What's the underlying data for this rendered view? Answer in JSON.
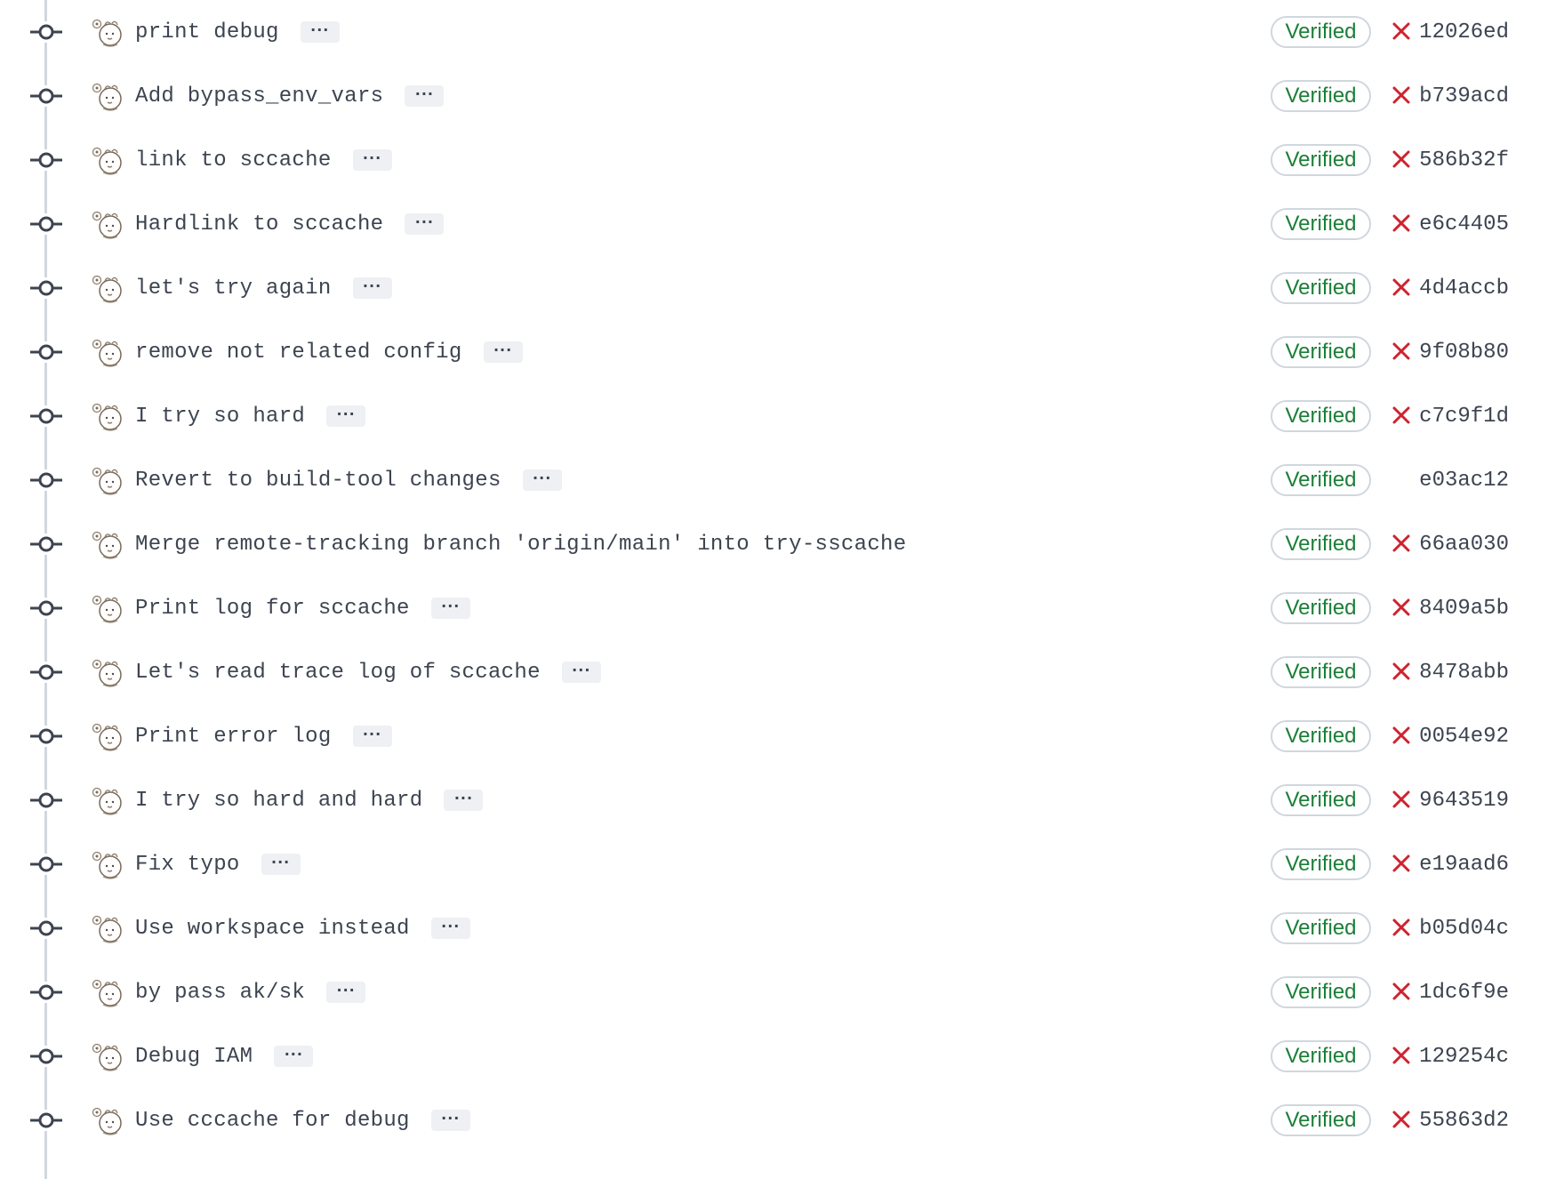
{
  "colors": {
    "timeline": "#d0d7de",
    "text": "#3d4450",
    "verified_text": "#1a7f37",
    "verified_border": "#d0d7de",
    "failure": "#cf222e",
    "ellipsis_bg": "#eef0f3"
  },
  "icons": {
    "node": "git-commit-icon",
    "avatar": "cartoon-avatar",
    "failure": "x-icon"
  },
  "commits": [
    {
      "message": "print debug",
      "has_ellipsis": true,
      "badge": "Verified",
      "status": "failure",
      "sha": "12026ed"
    },
    {
      "message": "Add bypass_env_vars",
      "has_ellipsis": true,
      "badge": "Verified",
      "status": "failure",
      "sha": "b739acd"
    },
    {
      "message": "link to sccache",
      "has_ellipsis": true,
      "badge": "Verified",
      "status": "failure",
      "sha": "586b32f"
    },
    {
      "message": "Hardlink to sccache",
      "has_ellipsis": true,
      "badge": "Verified",
      "status": "failure",
      "sha": "e6c4405"
    },
    {
      "message": "let's try again",
      "has_ellipsis": true,
      "badge": "Verified",
      "status": "failure",
      "sha": "4d4accb"
    },
    {
      "message": "remove not related config",
      "has_ellipsis": true,
      "badge": "Verified",
      "status": "failure",
      "sha": "9f08b80"
    },
    {
      "message": "I try so hard",
      "has_ellipsis": true,
      "badge": "Verified",
      "status": "failure",
      "sha": "c7c9f1d"
    },
    {
      "message": "Revert to build-tool changes",
      "has_ellipsis": true,
      "badge": "Verified",
      "status": "none",
      "sha": "e03ac12"
    },
    {
      "message": "Merge remote-tracking branch 'origin/main' into try-sscache",
      "has_ellipsis": false,
      "badge": "Verified",
      "status": "failure",
      "sha": "66aa030"
    },
    {
      "message": "Print log for sccache",
      "has_ellipsis": true,
      "badge": "Verified",
      "status": "failure",
      "sha": "8409a5b"
    },
    {
      "message": "Let's read trace log of sccache",
      "has_ellipsis": true,
      "badge": "Verified",
      "status": "failure",
      "sha": "8478abb"
    },
    {
      "message": "Print error log",
      "has_ellipsis": true,
      "badge": "Verified",
      "status": "failure",
      "sha": "0054e92"
    },
    {
      "message": "I try so hard and hard",
      "has_ellipsis": true,
      "badge": "Verified",
      "status": "failure",
      "sha": "9643519"
    },
    {
      "message": "Fix typo",
      "has_ellipsis": true,
      "badge": "Verified",
      "status": "failure",
      "sha": "e19aad6"
    },
    {
      "message": "Use workspace instead",
      "has_ellipsis": true,
      "badge": "Verified",
      "status": "failure",
      "sha": "b05d04c"
    },
    {
      "message": "by pass ak/sk",
      "has_ellipsis": true,
      "badge": "Verified",
      "status": "failure",
      "sha": "1dc6f9e"
    },
    {
      "message": "Debug IAM",
      "has_ellipsis": true,
      "badge": "Verified",
      "status": "failure",
      "sha": "129254c"
    },
    {
      "message": "Use cccache for debug",
      "has_ellipsis": true,
      "badge": "Verified",
      "status": "failure",
      "sha": "55863d2"
    }
  ]
}
